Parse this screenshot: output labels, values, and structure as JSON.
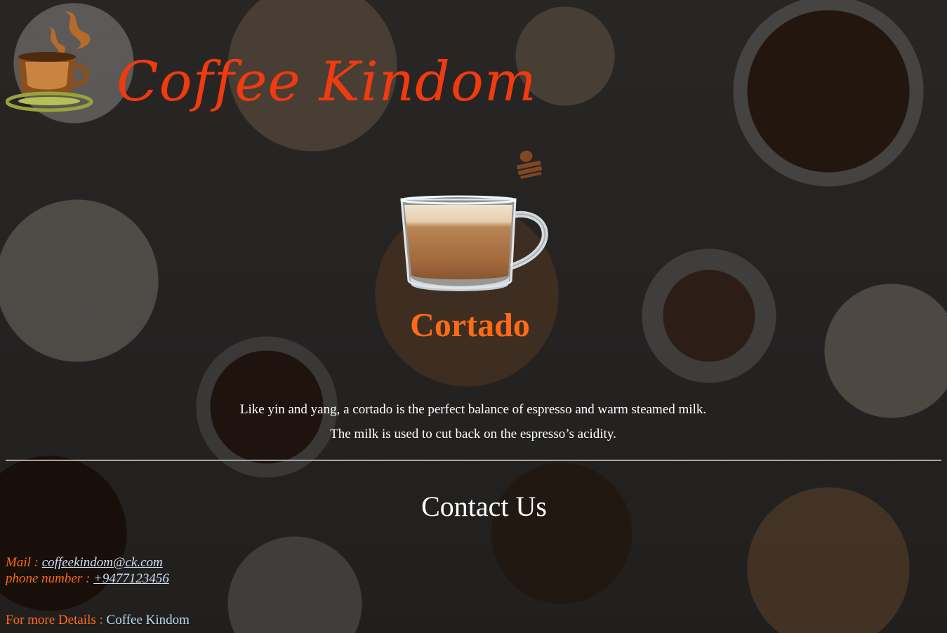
{
  "header": {
    "brand_title": "Coffee Kindom"
  },
  "product": {
    "name": "Cortado",
    "description": "Like yin and yang, a cortado is the perfect balance of espresso and warm steamed milk. The milk is used to cut back on the espresso’s acidity.",
    "image_icon": "glass-cup-cortado-icon"
  },
  "contact": {
    "heading": "Contact Us",
    "mail_label": "Mail : ",
    "mail_value": "coffeekindom@ck.com",
    "phone_label": "phone number : ",
    "phone_value": "+9477123456",
    "more_label": "For more Details : ",
    "more_link": "Coffee Kindom"
  },
  "colors": {
    "brand_red": "#f03a10",
    "accent_orange": "#ff6a18",
    "link_blue": "#cfe0f3",
    "text_white": "#ffffff"
  }
}
